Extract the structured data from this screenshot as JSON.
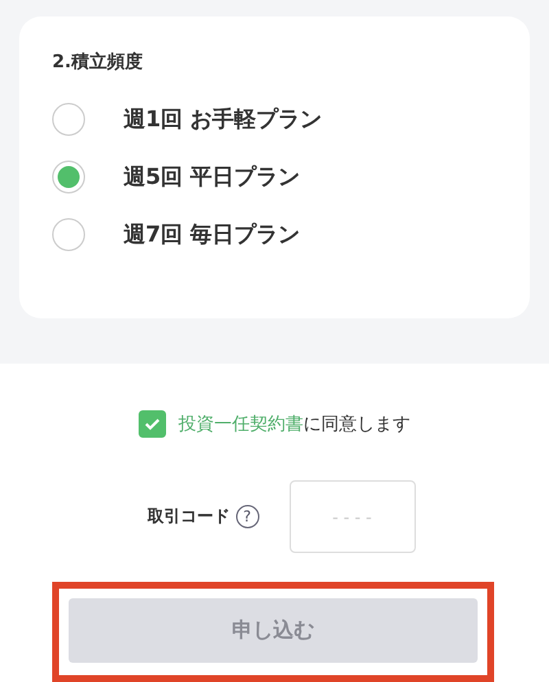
{
  "frequency": {
    "title": "2.積立頻度",
    "options": [
      {
        "label": "週1回 お手軽プラン",
        "selected": false
      },
      {
        "label": "週5回 平日プラン",
        "selected": true
      },
      {
        "label": "週7回 毎日プラン",
        "selected": false
      }
    ]
  },
  "agreement": {
    "checked": true,
    "link": "投資一任契約書",
    "text": "に同意します"
  },
  "trade_code": {
    "label": "取引コード",
    "help": "?",
    "placeholder": "- - - -"
  },
  "submit": {
    "label": "申し込む",
    "disabled": true,
    "highlighted": true
  }
}
